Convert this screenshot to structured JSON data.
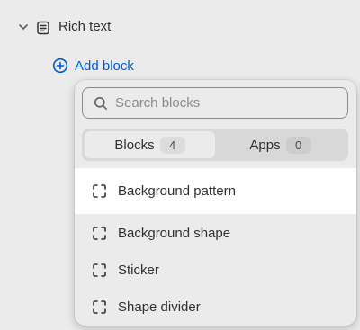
{
  "section": {
    "label": "Rich text",
    "chevron_icon": "chevron-down-icon",
    "icon": "text-block-icon"
  },
  "add_block": {
    "label": "Add block",
    "icon": "plus-circle-icon",
    "color": "#005bd3"
  },
  "popover": {
    "search": {
      "placeholder": "Search blocks",
      "value": "",
      "icon": "search-icon"
    },
    "tabs": [
      {
        "label": "Blocks",
        "count": "4",
        "active": true
      },
      {
        "label": "Apps",
        "count": "0",
        "active": false
      }
    ],
    "items": [
      {
        "label": "Background pattern",
        "icon": "block-frame-icon"
      },
      {
        "label": "Background shape",
        "icon": "block-frame-icon"
      },
      {
        "label": "Sticker",
        "icon": "block-frame-icon"
      },
      {
        "label": "Shape divider",
        "icon": "block-frame-icon"
      }
    ]
  }
}
